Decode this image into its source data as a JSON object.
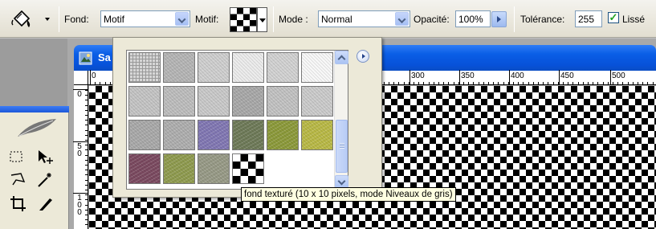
{
  "options_bar": {
    "fill_label": "Fond:",
    "fill_value": "Motif",
    "pattern_label": "Motif:",
    "mode_label": "Mode :",
    "mode_value": "Normal",
    "opacity_label": "Opacité:",
    "opacity_value": "100%",
    "tolerance_label": "Tolérance:",
    "tolerance_value": "255",
    "smooth_label": "Lissé",
    "smooth_checked": true
  },
  "document": {
    "title": "Sa",
    "ruler_h_labels": [
      "0",
      "300",
      "350",
      "400",
      "450",
      "500"
    ],
    "ruler_v_labels": [
      "0",
      "5\n0",
      "1\n0\n0"
    ]
  },
  "pattern_picker": {
    "tiles": [
      {
        "name": "grid-pattern",
        "color": "#d6d6d6"
      },
      {
        "name": "gray-noise",
        "color": "#b5b5b5"
      },
      {
        "name": "light-stucco",
        "color": "#cfcfcf"
      },
      {
        "name": "white-texture",
        "color": "#ececec"
      },
      {
        "name": "light-gray-grain",
        "color": "#d2d2d2"
      },
      {
        "name": "white-plain",
        "color": "#f8f8f8"
      },
      {
        "name": "gray-paper",
        "color": "#c4c4c4"
      },
      {
        "name": "gray-stone",
        "color": "#bdbdbd"
      },
      {
        "name": "gray-fibers",
        "color": "#c9c9c9"
      },
      {
        "name": "dark-gray-stone",
        "color": "#a8a8a8"
      },
      {
        "name": "gray-canvas",
        "color": "#c2c2c2"
      },
      {
        "name": "gray-crumple",
        "color": "#cbcbcb"
      },
      {
        "name": "mid-gray",
        "color": "#a9a9a9"
      },
      {
        "name": "gray-bumps",
        "color": "#aeaeae"
      },
      {
        "name": "purple-flowers",
        "color": "#8177b3"
      },
      {
        "name": "dark-leaves",
        "color": "#6e7a58"
      },
      {
        "name": "green-moss",
        "color": "#8c9a3a"
      },
      {
        "name": "yellow-green-texture",
        "color": "#b9b946"
      },
      {
        "name": "burgundy-texture",
        "color": "#7b4a60"
      },
      {
        "name": "olive-green",
        "color": "#8f9b4f"
      },
      {
        "name": "gray-pebbles",
        "color": "#979a86"
      },
      {
        "name": "checker-pattern",
        "color": "#ffffff"
      }
    ],
    "tooltip": "fond texturé (10 x 10 pixels, mode Niveaux de gris)"
  }
}
